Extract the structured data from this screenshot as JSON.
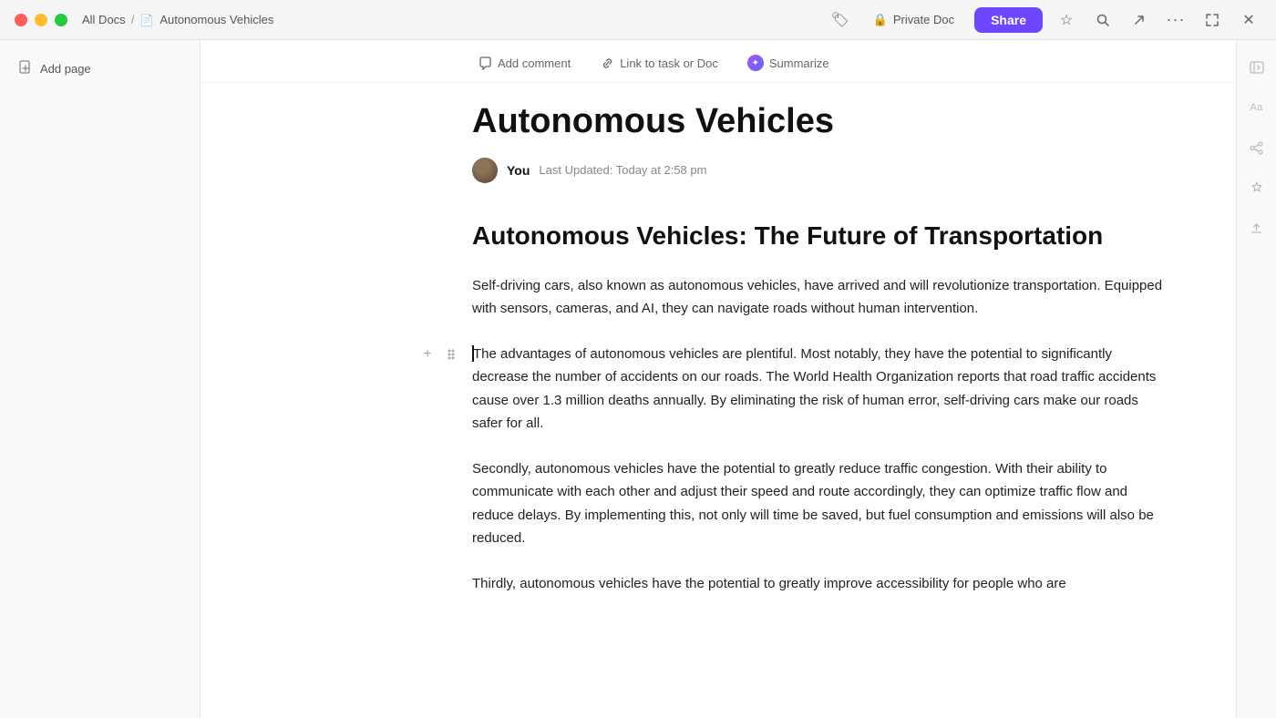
{
  "titleBar": {
    "breadcrumb": {
      "allDocs": "All Docs",
      "separator": "/",
      "docTitle": "Autonomous Vehicles"
    },
    "actions": {
      "privateDoc": "Private Doc",
      "shareLabel": "Share"
    }
  },
  "sidebar": {
    "addPageLabel": "Add page"
  },
  "toolbar": {
    "addComment": "Add comment",
    "linkToTask": "Link to task or Doc",
    "summarize": "Summarize"
  },
  "document": {
    "title": "Autonomous Vehicles",
    "author": "You",
    "lastUpdated": "Last Updated: Today at 2:58 pm",
    "heading": "Autonomous Vehicles: The Future of Transportation",
    "paragraph1": "Self-driving cars, also known as autonomous vehicles, have arrived and will revolutionize transportation. Equipped with sensors, cameras, and AI, they can navigate roads without human intervention.",
    "paragraph2": "The advantages of autonomous vehicles are plentiful. Most notably, they have the potential to significantly decrease the number of accidents on our roads. The World Health Organization reports that road traffic accidents cause over 1.3 million deaths annually. By eliminating the risk of human error, self-driving cars make our roads safer for all.",
    "paragraph3": "Secondly, autonomous vehicles have the potential to greatly reduce traffic congestion. With their ability to communicate with each other and adjust their speed and route accordingly, they can optimize traffic flow and reduce delays. By implementing this, not only will time be saved, but fuel consumption and emissions will also be reduced.",
    "paragraph4": "Thirdly, autonomous vehicles have the potential to greatly improve accessibility for people who are"
  },
  "rightSidebar": {
    "expandLabel": "Aa",
    "shareIcon": "share",
    "aiIcon": "ai",
    "uploadIcon": "upload"
  },
  "icons": {
    "plus": "+",
    "drag": "⠿",
    "comment": "💬",
    "link": "🔗",
    "star": "☆",
    "search": "⌕",
    "export": "↗",
    "more": "···",
    "expand": "⤢",
    "close": "✕",
    "lock": "🔒",
    "doc": "📄",
    "collapseLeft": "⇤",
    "expand2": "⇥"
  }
}
